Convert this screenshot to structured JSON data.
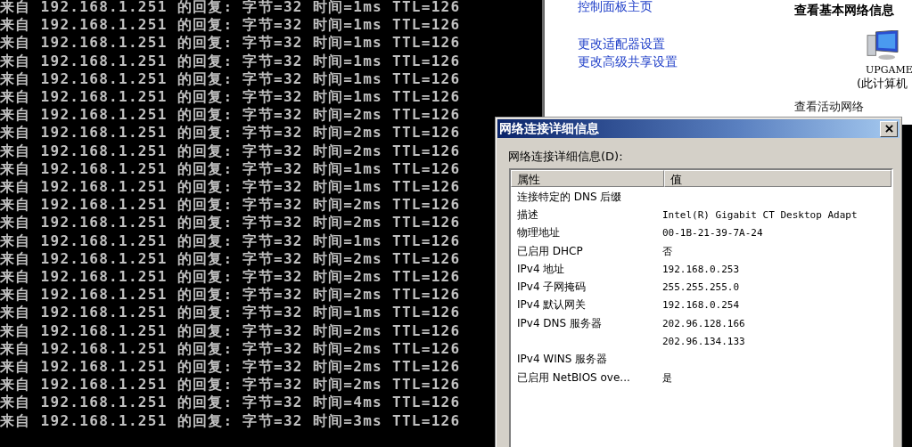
{
  "console": {
    "lines": [
      "来自 192.168.1.251 的回复: 字节=32 时间=1ms TTL=126",
      "来自 192.168.1.251 的回复: 字节=32 时间=1ms TTL=126",
      "来自 192.168.1.251 的回复: 字节=32 时间=1ms TTL=126",
      "来自 192.168.1.251 的回复: 字节=32 时间=1ms TTL=126",
      "来自 192.168.1.251 的回复: 字节=32 时间=1ms TTL=126",
      "来自 192.168.1.251 的回复: 字节=32 时间=1ms TTL=126",
      "来自 192.168.1.251 的回复: 字节=32 时间=2ms TTL=126",
      "来自 192.168.1.251 的回复: 字节=32 时间=2ms TTL=126",
      "来自 192.168.1.251 的回复: 字节=32 时间=2ms TTL=126",
      "来自 192.168.1.251 的回复: 字节=32 时间=1ms TTL=126",
      "来自 192.168.1.251 的回复: 字节=32 时间=1ms TTL=126",
      "来自 192.168.1.251 的回复: 字节=32 时间=2ms TTL=126",
      "来自 192.168.1.251 的回复: 字节=32 时间=2ms TTL=126",
      "来自 192.168.1.251 的回复: 字节=32 时间=1ms TTL=126",
      "来自 192.168.1.251 的回复: 字节=32 时间=2ms TTL=126",
      "来自 192.168.1.251 的回复: 字节=32 时间=2ms TTL=126",
      "来自 192.168.1.251 的回复: 字节=32 时间=2ms TTL=126",
      "来自 192.168.1.251 的回复: 字节=32 时间=1ms TTL=126",
      "来自 192.168.1.251 的回复: 字节=32 时间=2ms TTL=126",
      "来自 192.168.1.251 的回复: 字节=32 时间=2ms TTL=126",
      "来自 192.168.1.251 的回复: 字节=32 时间=2ms TTL=126",
      "来自 192.168.1.251 的回复: 字节=32 时间=2ms TTL=126",
      "来自 192.168.1.251 的回复: 字节=32 时间=4ms TTL=126",
      "来自 192.168.1.251 的回复: 字节=32 时间=3ms TTL=126"
    ]
  },
  "control_panel": {
    "links": [
      "控制面板主页",
      "更改适配器设置",
      "更改高级共享设置"
    ],
    "heading": "查看基本网络信息",
    "computer_name": "UPGAME",
    "computer_caption": "(此计算机",
    "section": "查看活动网络"
  },
  "dialog": {
    "title": "网络连接详细信息",
    "list_label": "网络连接详细信息(D):",
    "columns": [
      "属性",
      "值"
    ],
    "rows": [
      {
        "property": "连接特定的 DNS 后缀",
        "value": ""
      },
      {
        "property": "描述",
        "value": "Intel(R) Gigabit CT Desktop Adapt"
      },
      {
        "property": "物理地址",
        "value": "00-1B-21-39-7A-24"
      },
      {
        "property": "已启用 DHCP",
        "value": "否"
      },
      {
        "property": "IPv4 地址",
        "value": "192.168.0.253"
      },
      {
        "property": "IPv4 子网掩码",
        "value": "255.255.255.0"
      },
      {
        "property": "IPv4 默认网关",
        "value": "192.168.0.254"
      },
      {
        "property": "IPv4 DNS 服务器",
        "value": "202.96.128.166"
      },
      {
        "property": "",
        "value": "202.96.134.133"
      },
      {
        "property": "IPv4 WINS 服务器",
        "value": ""
      },
      {
        "property": "已启用 NetBIOS ove...",
        "value": "是"
      }
    ]
  }
}
